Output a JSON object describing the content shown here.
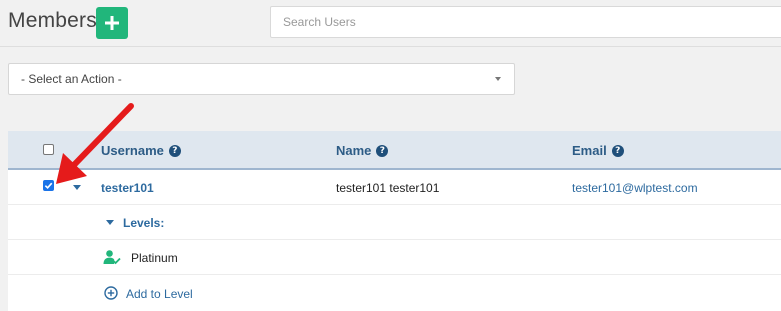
{
  "header": {
    "title": "Members",
    "add_icon": "plus-icon"
  },
  "search": {
    "placeholder": "Search Users",
    "value": ""
  },
  "action_select": {
    "selected": "- Select an Action -"
  },
  "table": {
    "columns": [
      {
        "label": "Username",
        "help_icon": "question-icon"
      },
      {
        "label": "Name",
        "help_icon": "question-icon"
      },
      {
        "label": "Email",
        "help_icon": "question-icon"
      }
    ],
    "rows": [
      {
        "checked": true,
        "username": "tester101",
        "name": "tester101 tester101",
        "email": "tester101@wlptest.com",
        "levels_label": "Levels:",
        "levels": [
          "Platinum"
        ],
        "add_to_level": "Add to Level"
      }
    ]
  },
  "annotation": {
    "arrow_color": "#e51b1b"
  },
  "colors": {
    "accent_green": "#21b67b",
    "link_blue": "#2d6a9f",
    "header_blue": "#2d5c86"
  }
}
